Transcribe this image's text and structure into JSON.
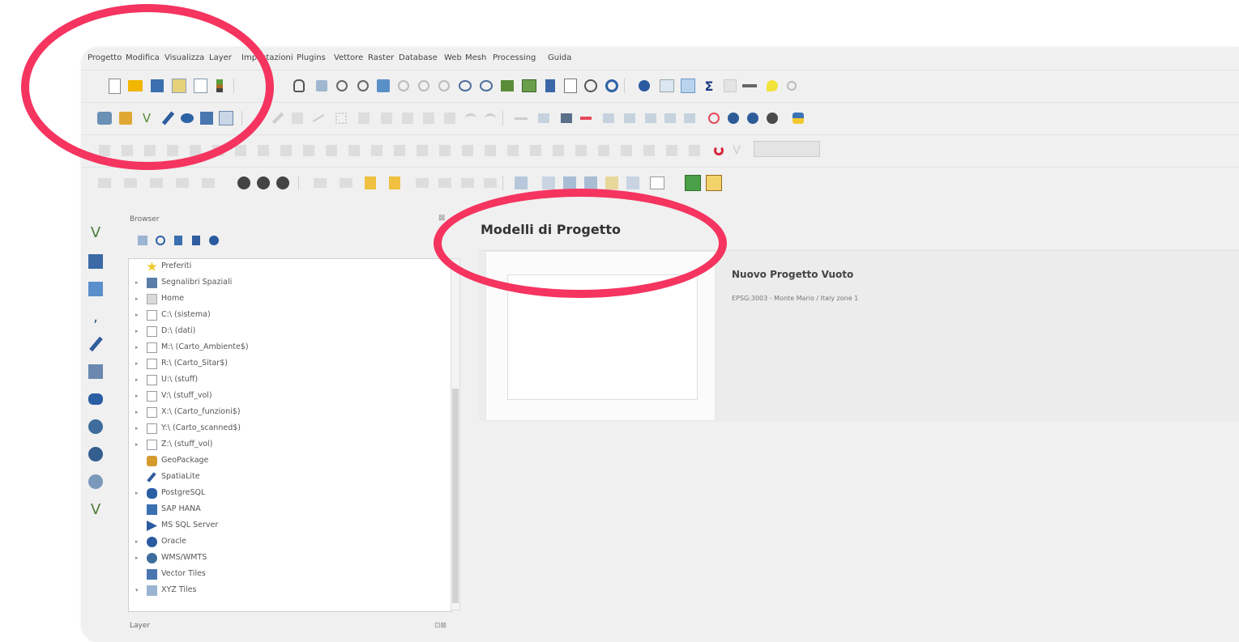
{
  "menubar": {
    "items": [
      "Progetto",
      "Modifica",
      "Visualizza",
      "Layer",
      "Impostazioni",
      "Plugins",
      "Vettore",
      "Raster",
      "Database",
      "Web",
      "Mesh",
      "Processing",
      "Guida"
    ]
  },
  "browser": {
    "title": "Browser",
    "close_label": "⊠",
    "items": [
      {
        "label": "Preferiti",
        "icon": "star-icon"
      },
      {
        "label": "Segnalibri Spaziali",
        "icon": "bookmark-icon"
      },
      {
        "label": "Home",
        "icon": "folder-icon"
      },
      {
        "label": "C:\\ (sistema)",
        "icon": "drive-icon"
      },
      {
        "label": "D:\\ (dati)",
        "icon": "drive-icon"
      },
      {
        "label": "M:\\ (Carto_Ambiente$)",
        "icon": "drive-icon"
      },
      {
        "label": "R:\\ (Carto_Sitar$)",
        "icon": "drive-icon"
      },
      {
        "label": "U:\\ (stuff)",
        "icon": "drive-icon"
      },
      {
        "label": "V:\\ (stuff_vol)",
        "icon": "drive-icon"
      },
      {
        "label": "X:\\ (Carto_funzioni$)",
        "icon": "drive-icon"
      },
      {
        "label": "Y:\\ (Carto_scanned$)",
        "icon": "drive-icon"
      },
      {
        "label": "Z:\\ (stuff_vol)",
        "icon": "drive-icon"
      },
      {
        "label": "GeoPackage",
        "icon": "geopackage-icon"
      },
      {
        "label": "SpatiaLite",
        "icon": "feather-icon"
      },
      {
        "label": "PostgreSQL",
        "icon": "elephant-icon"
      },
      {
        "label": "SAP HANA",
        "icon": "database-icon"
      },
      {
        "label": "MS SQL Server",
        "icon": "mssql-icon"
      },
      {
        "label": "Oracle",
        "icon": "oracle-icon"
      },
      {
        "label": "WMS/WMTS",
        "icon": "globe-icon"
      },
      {
        "label": "Vector Tiles",
        "icon": "grid-icon"
      },
      {
        "label": "XYZ Tiles",
        "icon": "grid-icon"
      }
    ]
  },
  "layer_panel": {
    "title": "Layer",
    "close_label": "⊡⊠"
  },
  "templates": {
    "title": "Modelli di Progetto",
    "card_name": "Nuovo Progetto Vuoto",
    "card_crs": "EPSG:3003 - Monte Mario / Italy zone 1"
  },
  "colors": {
    "highlight_circle": "#f5345f"
  }
}
